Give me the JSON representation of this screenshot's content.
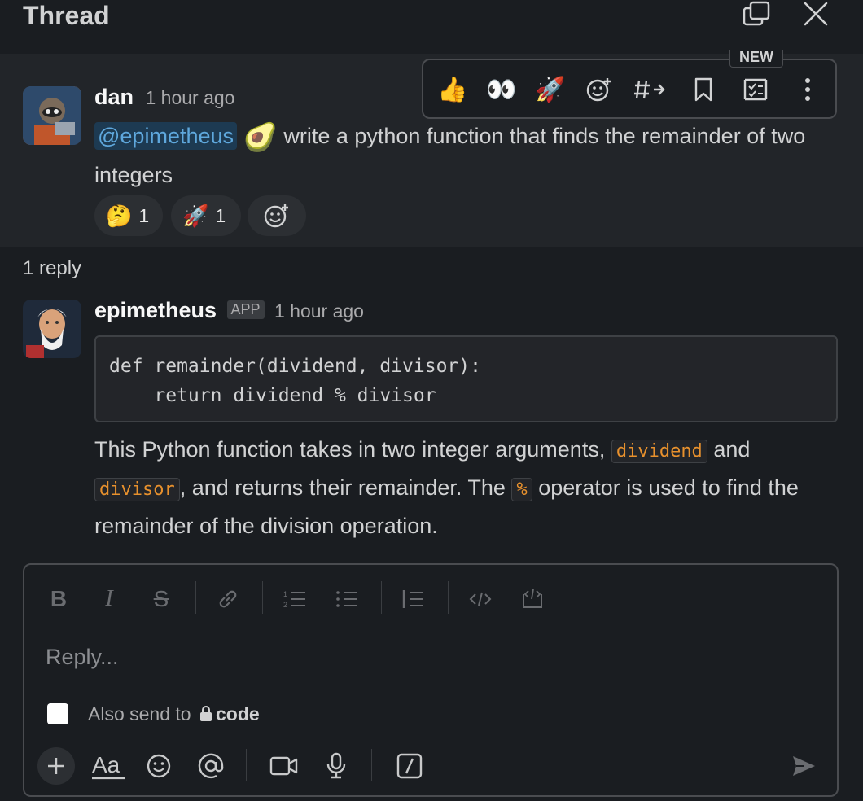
{
  "header": {
    "title": "Thread"
  },
  "parent_message": {
    "author": "dan",
    "time": "1 hour ago",
    "mention": "@epimetheus",
    "text_after_mention": " write a python function that finds the remainder of two integers",
    "reactions": [
      {
        "emoji": "🤔",
        "count": "1"
      },
      {
        "emoji": "🚀",
        "count": "1"
      }
    ]
  },
  "hover_toolbar": {
    "new_badge": "NEW",
    "items": [
      "👍",
      "👀",
      "🚀",
      "add-reaction",
      "forward",
      "bookmark",
      "save-task",
      "more"
    ]
  },
  "replies": {
    "count_label": "1 reply"
  },
  "reply_message": {
    "author": "epimetheus",
    "badge": "APP",
    "time": "1 hour ago",
    "code": "def remainder(dividend, divisor):\n    return dividend % divisor",
    "text": {
      "p1": "This Python function takes in two integer arguments, ",
      "code1": "dividend",
      "p2": " and ",
      "code2": "divisor",
      "p3": ", and returns their remainder. The ",
      "code3": "%",
      "p4": " operator is used to find the remainder of the division operation."
    }
  },
  "composer": {
    "placeholder": "Reply...",
    "also_send_label": "Also send to",
    "channel": "code",
    "format_buttons": [
      "bold",
      "italic",
      "strikethrough",
      "link",
      "ordered-list",
      "bulleted-list",
      "blockquote",
      "code",
      "code-block"
    ]
  },
  "colors": {
    "background": "#1a1d21",
    "parent_bg": "#222529",
    "mention": "#5fa8dd",
    "inline_code": "#e8912d"
  }
}
